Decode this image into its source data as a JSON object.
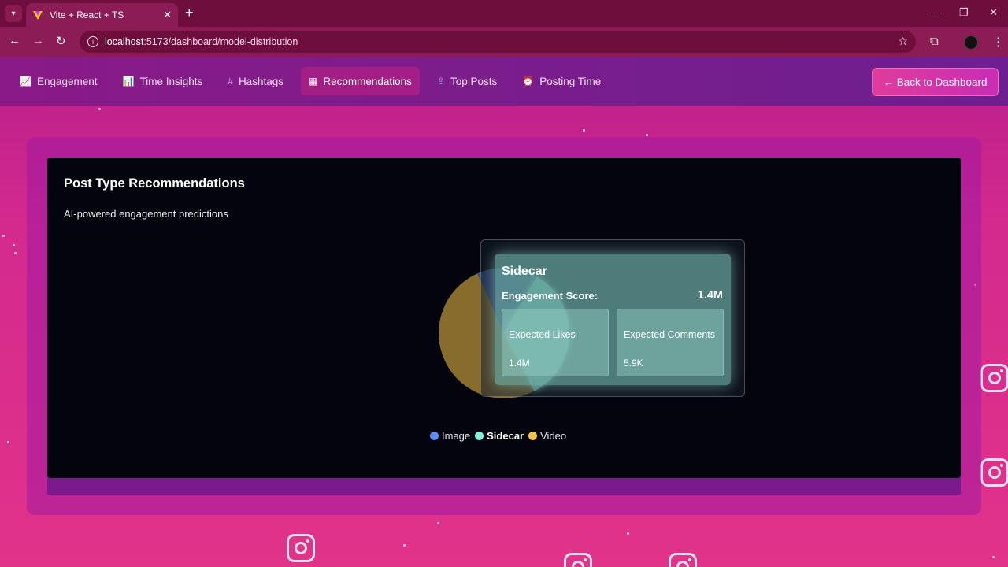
{
  "browser": {
    "tab_title": "Vite + React + TS",
    "url_host": "localhost",
    "url_rest": ":5173/dashboard/model-distribution"
  },
  "nav": {
    "items": [
      {
        "icon": "chart-icon",
        "label": "Engagement"
      },
      {
        "icon": "bar-chart-icon",
        "label": "Time Insights"
      },
      {
        "icon": "hash-icon",
        "label": "Hashtags"
      },
      {
        "icon": "calculator-icon",
        "label": "Recommendations",
        "active": true
      },
      {
        "icon": "upload-icon",
        "label": "Top Posts"
      },
      {
        "icon": "alarm-clock-icon",
        "label": "Posting Time"
      }
    ],
    "back_label": "← Back to  Dashboard"
  },
  "card": {
    "title": "Post Type Recommendations",
    "subtitle": "AI-powered engagement predictions"
  },
  "tooltip": {
    "title": "Sidecar",
    "score_label": "Engagement Score:",
    "score_value": "1.4M",
    "likes_label": "Expected Likes",
    "likes_value": "1.4M",
    "comments_label": "Expected Comments",
    "comments_value": "5.9K"
  },
  "chart_data": {
    "type": "pie",
    "categories": [
      "Image",
      "Sidecar",
      "Video"
    ],
    "values": [
      15,
      34,
      51
    ],
    "colors": [
      "#5b8ff0",
      "#86f0de",
      "#f5c34a"
    ],
    "legend_position": "bottom",
    "highlighted": "Sidecar"
  },
  "legend": [
    {
      "label": "Image",
      "color": "#5b8ff0",
      "bold": false
    },
    {
      "label": "Sidecar",
      "color": "#86f0de",
      "bold": true
    },
    {
      "label": "Video",
      "color": "#f5c34a",
      "bold": false
    }
  ]
}
